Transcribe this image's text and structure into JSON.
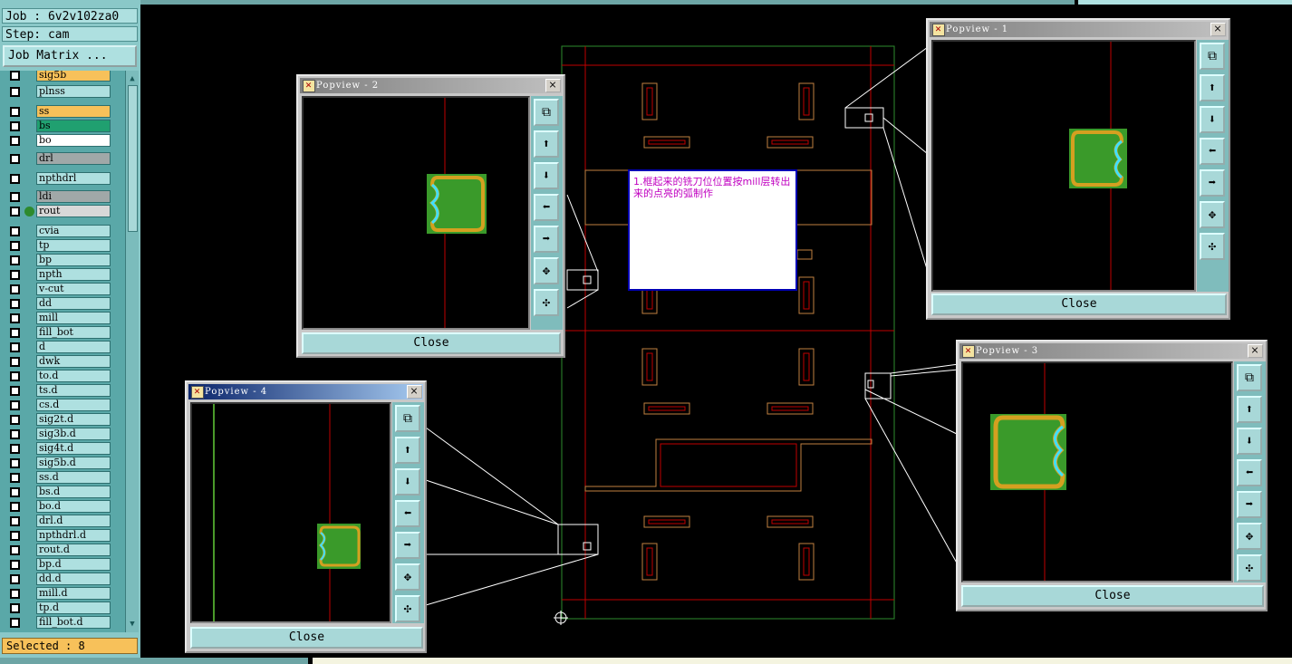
{
  "job_info": {
    "job": "Job : 6v2v102za0",
    "step": "Step: cam"
  },
  "job_matrix_button": "Job Matrix ...",
  "layers": [
    {
      "name": "sig5b",
      "color": "#f7c15a"
    },
    {
      "name": "plnss",
      "color": "#aee0e0"
    },
    {
      "name": "ss",
      "color": "#f7c15a"
    },
    {
      "name": "bs",
      "color": "#20a070"
    },
    {
      "name": "bo",
      "color": "#ffffff"
    },
    {
      "name": "drl",
      "color": "#a0a8a8"
    },
    {
      "name": "npthdrl",
      "color": "#aee0e0"
    },
    {
      "name": "ldi",
      "color": "#a0a8a8"
    },
    {
      "name": "rout",
      "color": "#d8d8d8",
      "active": true
    },
    {
      "name": "cvia",
      "color": "#aee0e0"
    },
    {
      "name": "tp",
      "color": "#aee0e0"
    },
    {
      "name": "bp",
      "color": "#aee0e0"
    },
    {
      "name": "npth",
      "color": "#aee0e0"
    },
    {
      "name": "v-cut",
      "color": "#aee0e0"
    },
    {
      "name": "dd",
      "color": "#aee0e0"
    },
    {
      "name": "mill",
      "color": "#aee0e0"
    },
    {
      "name": "fill_bot",
      "color": "#aee0e0"
    },
    {
      "name": "d",
      "color": "#aee0e0"
    },
    {
      "name": "dwk",
      "color": "#aee0e0"
    },
    {
      "name": "to.d",
      "color": "#aee0e0"
    },
    {
      "name": "ts.d",
      "color": "#aee0e0"
    },
    {
      "name": "cs.d",
      "color": "#aee0e0"
    },
    {
      "name": "sig2t.d",
      "color": "#aee0e0"
    },
    {
      "name": "sig3b.d",
      "color": "#aee0e0"
    },
    {
      "name": "sig4t.d",
      "color": "#aee0e0"
    },
    {
      "name": "sig5b.d",
      "color": "#aee0e0"
    },
    {
      "name": "ss.d",
      "color": "#aee0e0"
    },
    {
      "name": "bs.d",
      "color": "#aee0e0"
    },
    {
      "name": "bo.d",
      "color": "#aee0e0"
    },
    {
      "name": "drl.d",
      "color": "#aee0e0"
    },
    {
      "name": "npthdrl.d",
      "color": "#aee0e0"
    },
    {
      "name": "rout.d",
      "color": "#aee0e0"
    },
    {
      "name": "bp.d",
      "color": "#aee0e0"
    },
    {
      "name": "dd.d",
      "color": "#aee0e0"
    },
    {
      "name": "mill.d",
      "color": "#aee0e0"
    },
    {
      "name": "tp.d",
      "color": "#aee0e0"
    },
    {
      "name": "fill_bot.d",
      "color": "#aee0e0"
    }
  ],
  "selected_status": "Selected : 8",
  "popviews": {
    "pv1": {
      "title": "Popview - 1",
      "close": "Close",
      "close_x": "×"
    },
    "pv2": {
      "title": "Popview - 2",
      "close": "Close",
      "close_x": "×"
    },
    "pv3": {
      "title": "Popview - 3",
      "close": "Close",
      "close_x": "×"
    },
    "pv4": {
      "title": "Popview - 4",
      "close": "Close",
      "close_x": "×"
    }
  },
  "popview_tool_icons": [
    "zoom-fit-icon",
    "pan-up-icon",
    "pan-down-icon",
    "pan-left-icon",
    "pan-right-icon",
    "zoom-in-icon",
    "zoom-out-icon"
  ],
  "note_text": "1.框起来的铣刀位位置按mill层转出来的点亮的弧制作",
  "colors": {
    "board_outline": "#2e8b2e",
    "profile": "#c00000",
    "pad": "#c08040",
    "panel_bg": "#000000",
    "ui_teal": "#9fd6d6"
  }
}
